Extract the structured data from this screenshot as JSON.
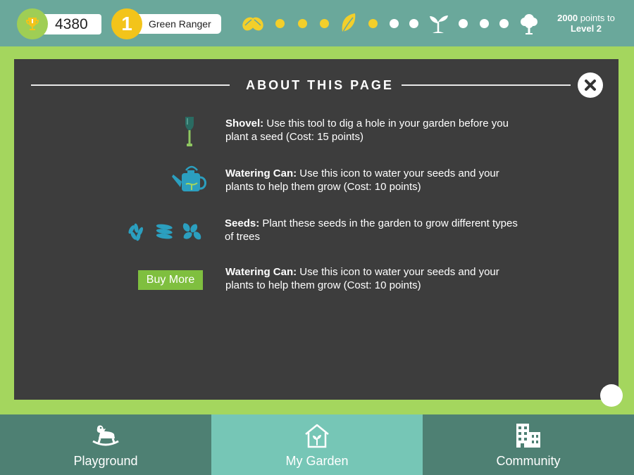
{
  "header": {
    "score": "4380",
    "level_number": "1",
    "rank_title": "Green Ranger",
    "progress_items": [
      {
        "icon": "seeds-icon",
        "state": "done"
      },
      {
        "icon": "dot",
        "state": "done"
      },
      {
        "icon": "dot",
        "state": "done"
      },
      {
        "icon": "dot",
        "state": "done"
      },
      {
        "icon": "leaf-icon",
        "state": "done"
      },
      {
        "icon": "dot",
        "state": "done"
      },
      {
        "icon": "dot",
        "state": "pending"
      },
      {
        "icon": "dot",
        "state": "pending"
      },
      {
        "icon": "sprout-icon",
        "state": "pending"
      },
      {
        "icon": "dot",
        "state": "pending"
      },
      {
        "icon": "dot",
        "state": "pending"
      },
      {
        "icon": "dot",
        "state": "pending"
      },
      {
        "icon": "tree-icon",
        "state": "pending"
      }
    ],
    "points_amount": "2000",
    "points_suffix": " points to",
    "next_level": "Level 2"
  },
  "modal": {
    "title": "ABOUT THIS PAGE",
    "items": [
      {
        "icon": "shovel-icon",
        "term": "Shovel:",
        "description": " Use this tool to dig a hole in your garden before you plant a seed (Cost: 15 points)"
      },
      {
        "icon": "watering-can-icon",
        "term": "Watering Can:",
        "description": " Use this icon to water your seeds and your plants to help them grow (Cost: 10 points)"
      },
      {
        "icon": "seeds-icon",
        "term": "Seeds:",
        "description": " Plant these seeds in the garden to grow different types of trees"
      },
      {
        "icon": "buy-more-button",
        "term": "Watering Can:",
        "description": " Use this icon to water your seeds and your plants to help them grow (Cost: 10 points)"
      }
    ],
    "buy_more_label": "Buy More"
  },
  "nav": {
    "tabs": [
      {
        "label": "Playground",
        "icon": "rocking-horse-icon",
        "active": false
      },
      {
        "label": "My Garden",
        "icon": "greenhouse-icon",
        "active": true
      },
      {
        "label": "Community",
        "icon": "buildings-icon",
        "active": false
      }
    ]
  },
  "colors": {
    "accent_green": "#a4d65e",
    "header_teal": "#6aa89b",
    "gold": "#f3c41a",
    "modal_bg": "#3d3d3d",
    "icon_blue": "#2b9fbf",
    "nav_dark": "#4e8073",
    "nav_active": "#76c6b6"
  }
}
